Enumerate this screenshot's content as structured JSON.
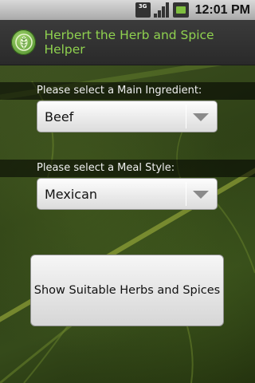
{
  "status_bar": {
    "network": "3G",
    "time": "12:01 PM"
  },
  "app": {
    "title": "Herbert the Herb and Spice Helper",
    "icon": "leaf-icon"
  },
  "form": {
    "main_ingredient": {
      "label": "Please select a Main Ingredient:",
      "selected": "Beef"
    },
    "meal_style": {
      "label": "Please select a Meal Style:",
      "selected": "Mexican"
    },
    "submit_label": "Show Suitable Herbs and Spices"
  },
  "colors": {
    "title_text": "#8fd14f",
    "title_bar": "#333333",
    "status_bar": "#bdbdbd"
  }
}
